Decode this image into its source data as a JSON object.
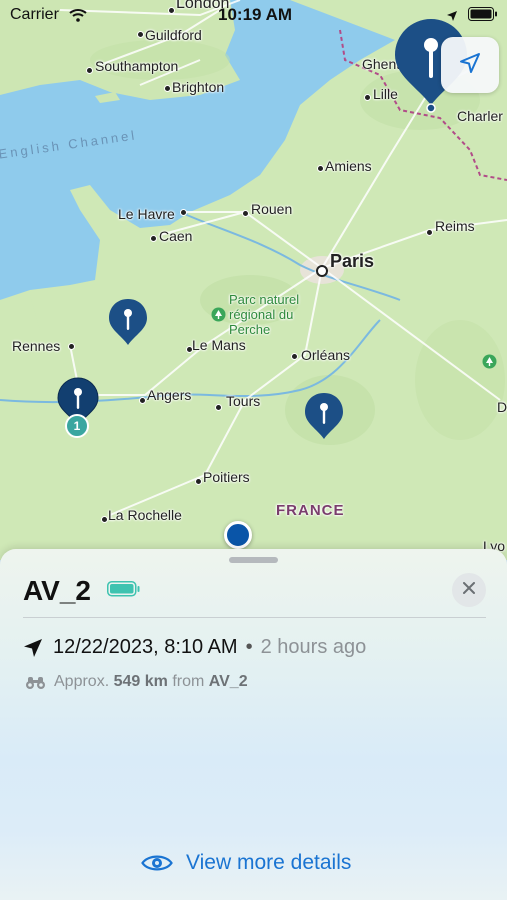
{
  "status_bar": {
    "carrier": "Carrier",
    "time": "10:19 AM"
  },
  "map": {
    "labels": {
      "london": "London",
      "guildford": "Guildford",
      "southampton": "Southampton",
      "brighton": "Brighton",
      "english_channel": "English Channel",
      "ghent": "Ghent",
      "lille": "Lille",
      "charleroi": "Charler",
      "amiens": "Amiens",
      "le_havre": "Le Havre",
      "rouen": "Rouen",
      "caen": "Caen",
      "reims": "Reims",
      "paris": "Paris",
      "park": "Parc naturel\nrégional du\nPerche",
      "rennes": "Rennes",
      "le_mans": "Le Mans",
      "orleans": "Orléans",
      "angers": "Angers",
      "tours": "Tours",
      "poitiers": "Poitiers",
      "la_rochelle": "La Rochelle",
      "france": "FRANCE",
      "lyon": "Lyo",
      "d_edge": "D"
    },
    "cluster_count": "1",
    "colors": {
      "pin": "#1c4f86",
      "cluster": "#3aa6a0",
      "user": "#0a55a8",
      "land": "#cfe8b6",
      "sea": "#8fcbec"
    }
  },
  "sheet": {
    "device_name": "AV_2",
    "battery_color": "#3ec3b0",
    "timestamp": "12/22/2023, 8:10 AM",
    "separator": "•",
    "relative_time": "2 hours ago",
    "approx_prefix": "Approx.",
    "distance": "549 km",
    "from_text": "from",
    "from_device": "AV_2",
    "details_label": "View more details",
    "accent": "#1a74d2"
  }
}
